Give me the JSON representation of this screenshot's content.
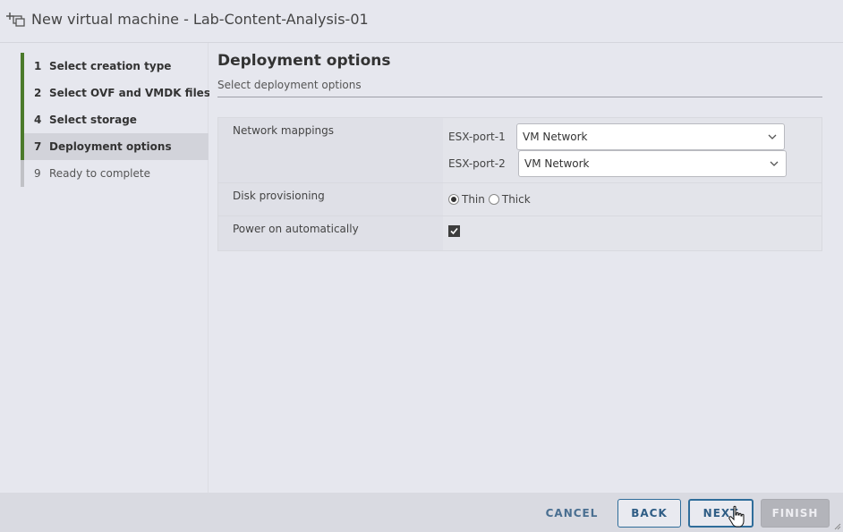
{
  "window": {
    "title": "New virtual machine - Lab-Content-Analysis-01"
  },
  "steps": [
    {
      "num": "1",
      "label": "Select creation type"
    },
    {
      "num": "2",
      "label": "Select OVF and VMDK files"
    },
    {
      "num": "4",
      "label": "Select storage"
    },
    {
      "num": "7",
      "label": "Deployment options"
    },
    {
      "num": "9",
      "label": "Ready to complete"
    }
  ],
  "main": {
    "title": "Deployment options",
    "subtitle": "Select deployment options",
    "network_label": "Network mappings",
    "ports": [
      {
        "label": "ESX-port-1",
        "value": "VM Network"
      },
      {
        "label": "ESX-port-2",
        "value": "VM Network"
      }
    ],
    "disk_label": "Disk provisioning",
    "disk_options": [
      "Thin",
      "Thick"
    ],
    "disk_selected": "Thin",
    "power_label": "Power on automatically",
    "power_checked": true
  },
  "footer": {
    "cancel": "CANCEL",
    "back": "BACK",
    "next": "NEXT",
    "finish": "FINISH"
  }
}
